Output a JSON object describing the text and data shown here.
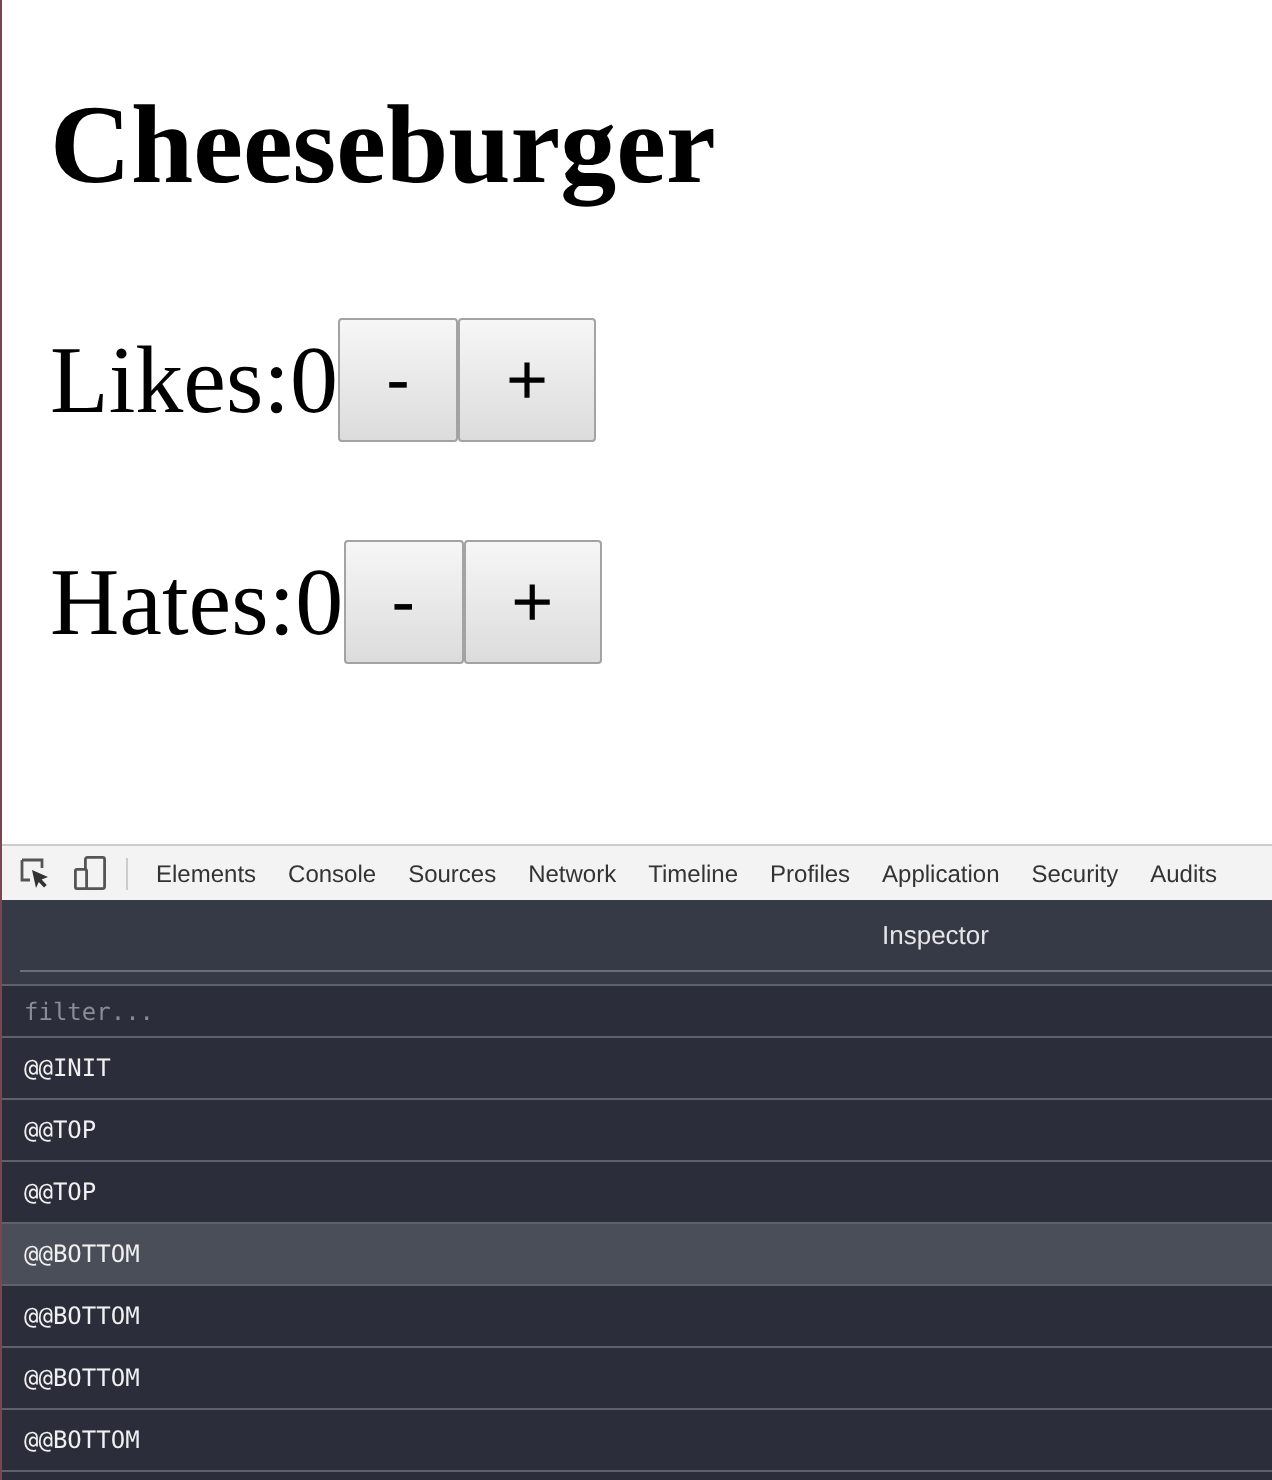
{
  "page": {
    "title": "Cheeseburger",
    "counters": [
      {
        "label": "Likes:0",
        "buttons": [
          "-",
          "+"
        ]
      },
      {
        "label": "Hates:0",
        "buttons": [
          "-",
          "+"
        ]
      }
    ]
  },
  "devtools": {
    "tabs": [
      {
        "label": "Elements",
        "selected": false
      },
      {
        "label": "Console",
        "selected": false
      },
      {
        "label": "Sources",
        "selected": false
      },
      {
        "label": "Network",
        "selected": false
      },
      {
        "label": "Timeline",
        "selected": false
      },
      {
        "label": "Profiles",
        "selected": false
      },
      {
        "label": "Application",
        "selected": false
      },
      {
        "label": "Security",
        "selected": false
      },
      {
        "label": "Audits",
        "selected": false
      }
    ],
    "panel": {
      "title": "Inspector",
      "filter": {
        "placeholder": "filter..."
      },
      "actions": [
        {
          "label": "@@INIT",
          "selected": false
        },
        {
          "label": "@@TOP",
          "selected": false
        },
        {
          "label": "@@TOP",
          "selected": false
        },
        {
          "label": "@@BOTTOM",
          "selected": true
        },
        {
          "label": "@@BOTTOM",
          "selected": false
        },
        {
          "label": "@@BOTTOM",
          "selected": false
        },
        {
          "label": "@@BOTTOM",
          "selected": false
        }
      ]
    }
  }
}
